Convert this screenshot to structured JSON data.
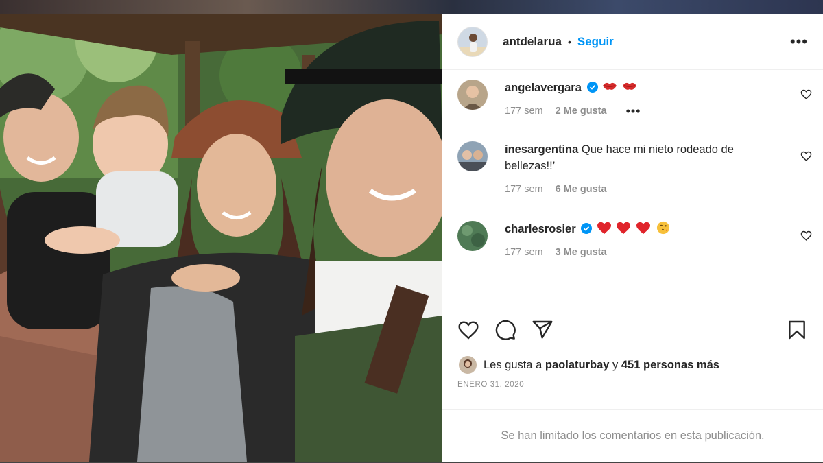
{
  "header": {
    "username": "antdelarua",
    "dot": "•",
    "follow_label": "Seguir",
    "more_label": "•••"
  },
  "comments": [
    {
      "username": "angelavergara",
      "verified": true,
      "text": "",
      "emojis": [
        "kiss-lips",
        "kiss-lips"
      ],
      "time": "177 sem",
      "likes": "2 Me gusta",
      "more": "•••"
    },
    {
      "username": "inesargentina",
      "verified": false,
      "text": "Que hace mi nieto rodeado de bellezas!!’",
      "time": "177 sem",
      "likes": "6 Me gusta"
    },
    {
      "username": "charlesrosier",
      "verified": true,
      "text": "",
      "emojis": [
        "red-heart",
        "red-heart",
        "red-heart",
        "winking-kiss-face"
      ],
      "time": "177 sem",
      "likes": "3 Me gusta"
    }
  ],
  "likes_line": {
    "prefix": "Les gusta a",
    "user": "paolaturbay",
    "conj": "y",
    "count": "451 personas más"
  },
  "date": "ENERO 31, 2020",
  "limited_notice": "Se han limitado los comentarios en esta publicación.",
  "icons": [
    "heart-icon",
    "comment-icon",
    "share-icon",
    "save-icon",
    "verified-badge-icon",
    "like-comment-icon"
  ],
  "colors": {
    "link_blue": "#0095f6",
    "text": "#262626",
    "muted": "#8e8e8e",
    "verified_blue": "#0095f6"
  }
}
